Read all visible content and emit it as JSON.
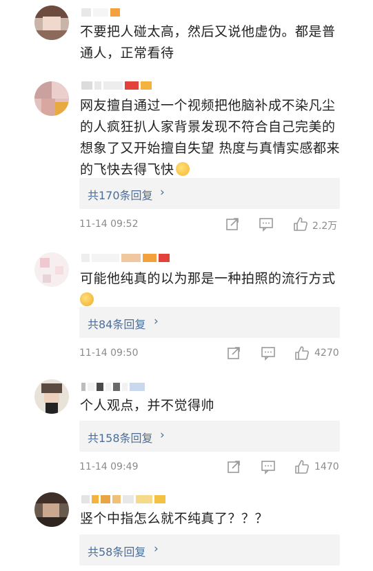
{
  "comments": [
    {
      "text": "不要把人碰太高，然后又说他虚伪。都是普通人，正常看待",
      "has_emoji": false
    },
    {
      "text": "网友擅自通过一个视频把他脑补成不染凡尘的人疯狂扒人家背景发现不符合自己完美的想象了又开始擅自失望 热度与真情实感都来的飞快去得飞快",
      "has_emoji": true,
      "replies_label": "共170条回复",
      "time": "11-14 09:52",
      "likes": "2.2万"
    },
    {
      "text": "可能他纯真的以为那是一种拍照的流行方式",
      "has_emoji": true,
      "replies_label": "共84条回复",
      "time": "11-14 09:50",
      "likes": "4270"
    },
    {
      "text": "个人观点，并不觉得帅",
      "has_emoji": false,
      "replies_label": "共158条回复",
      "time": "11-14 09:49",
      "likes": "1470"
    },
    {
      "text": "竖个中指怎么就不纯真了？？？",
      "has_emoji": false,
      "replies_label": "共58条回复"
    }
  ],
  "icons": {
    "share": "share-icon",
    "comment": "comment-icon",
    "like": "thumbs-up-icon",
    "chevron": "chevron-right-icon"
  },
  "colors": {
    "link": "#4a6d9a",
    "meta": "#8a8a8a",
    "reply_bg": "#f3f3f3"
  }
}
